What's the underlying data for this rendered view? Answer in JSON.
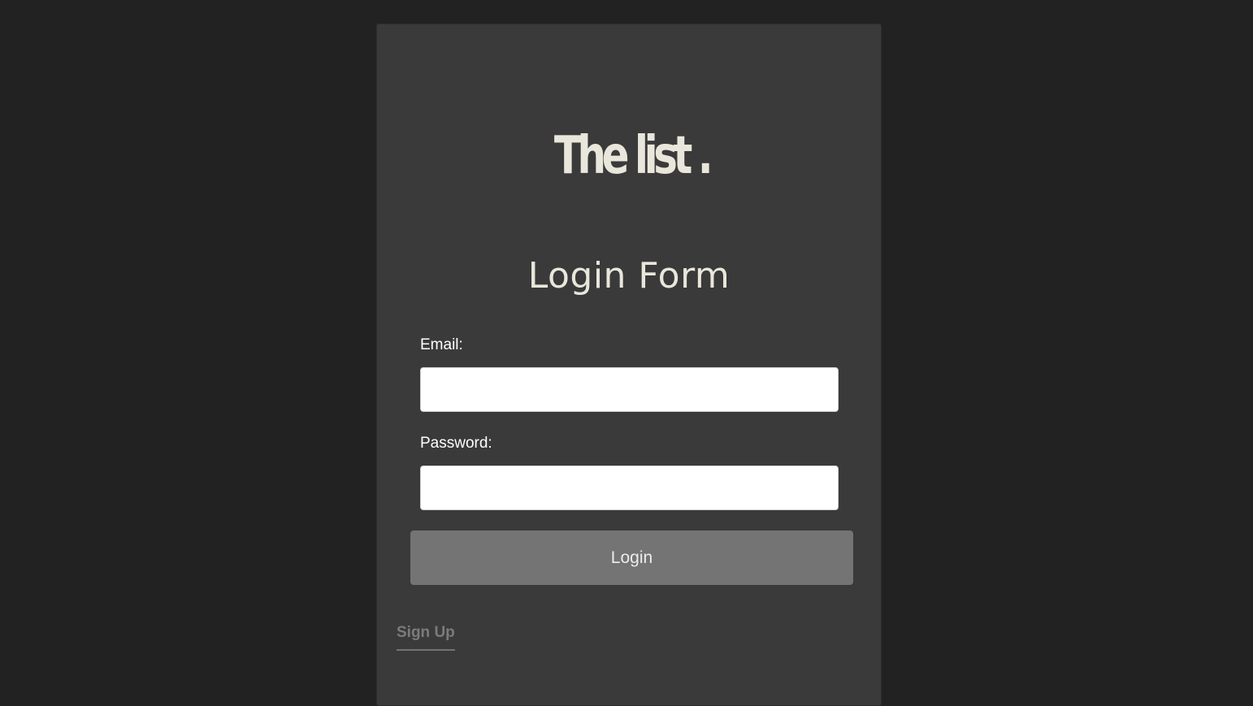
{
  "logo": {
    "text": "The list ."
  },
  "form": {
    "title": "Login Form",
    "email_label": "Email:",
    "email_value": "",
    "password_label": "Password:",
    "password_value": "",
    "login_label": "Login",
    "signup_label": "Sign Up"
  },
  "colors": {
    "page_background": "#222222",
    "card_background": "#3a3a3a",
    "logo_text": "#e9e6db",
    "login_button": "#747474",
    "signup_link": "#7b7b7b"
  }
}
